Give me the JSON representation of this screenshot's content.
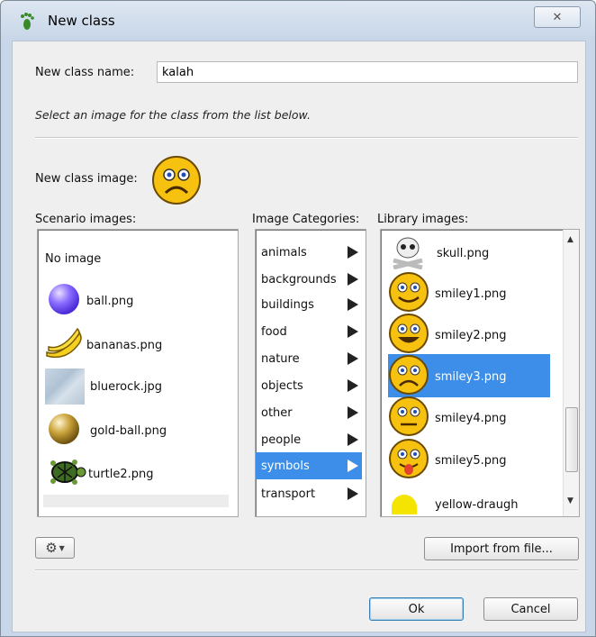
{
  "window": {
    "title": "New class",
    "close_label": "✕"
  },
  "form": {
    "name_label": "New class name:",
    "name_value": "kalah",
    "hint": "Select an image for the class from the list below.",
    "image_label": "New class image:"
  },
  "scenario": {
    "header": "Scenario images:",
    "items": [
      {
        "label": "No image",
        "icon": "none"
      },
      {
        "label": "ball.png",
        "icon": "purple-ball-icon"
      },
      {
        "label": "bananas.png",
        "icon": "bananas-icon"
      },
      {
        "label": "bluerock.jpg",
        "icon": "bluerock-texture-icon"
      },
      {
        "label": "gold-ball.png",
        "icon": "gold-ball-icon"
      },
      {
        "label": "turtle2.png",
        "icon": "turtle-icon"
      }
    ]
  },
  "categories": {
    "header": "Image Categories:",
    "items": [
      "animals",
      "backgrounds",
      "buildings",
      "food",
      "nature",
      "objects",
      "other",
      "people",
      "symbols",
      "transport"
    ],
    "selected": "symbols"
  },
  "library": {
    "header": "Library images:",
    "items": [
      {
        "label": "skull.png",
        "icon": "skull-icon"
      },
      {
        "label": "smiley1.png",
        "icon": "smiley-happy-icon"
      },
      {
        "label": "smiley2.png",
        "icon": "smiley-grin-icon"
      },
      {
        "label": "smiley3.png",
        "icon": "smiley-sad-icon"
      },
      {
        "label": "smiley4.png",
        "icon": "smiley-neutral-icon"
      },
      {
        "label": "smiley5.png",
        "icon": "smiley-tongue-icon"
      },
      {
        "label": "yellow-draugh",
        "icon": "yellow-draught-icon"
      }
    ],
    "selected": "smiley3.png"
  },
  "buttons": {
    "import": "Import from file...",
    "ok": "Ok",
    "cancel": "Cancel",
    "gear_icon": "gear-icon"
  },
  "colors": {
    "selection": "#3d8ee8",
    "smiley_yellow": "#f6c20f"
  }
}
